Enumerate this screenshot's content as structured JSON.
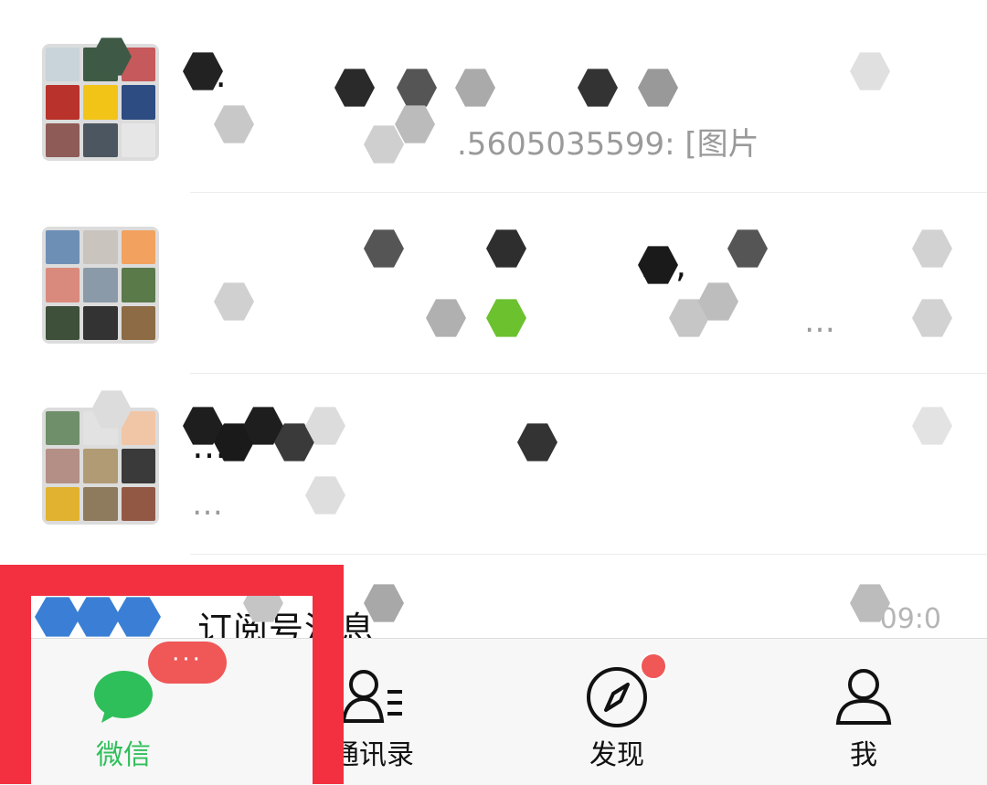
{
  "chats": [
    {
      "title": "…",
      "preview": "…：[图片]",
      "preview_tail": ".5605035599: [图片",
      "time": ""
    },
    {
      "title": "…,",
      "preview": "…",
      "preview_tail": "…",
      "time": ""
    },
    {
      "title": "…",
      "preview": "…",
      "preview_tail": "",
      "time": ""
    },
    {
      "title": "订阅号消息",
      "preview": "",
      "preview_tail": "",
      "time": "09:0"
    }
  ],
  "tabbar": {
    "tabs": [
      {
        "label": "微信",
        "icon": "chat-bubble-icon",
        "active": true
      },
      {
        "label": "通讯录",
        "icon": "contacts-icon",
        "active": false
      },
      {
        "label": "发现",
        "icon": "compass-icon",
        "active": false
      },
      {
        "label": "我",
        "icon": "person-icon",
        "active": false
      }
    ],
    "chat_badge": "···"
  },
  "colors": {
    "accent_green": "#2fbf5a",
    "badge_red": "#f05757",
    "highlight_red": "#f2303f"
  }
}
